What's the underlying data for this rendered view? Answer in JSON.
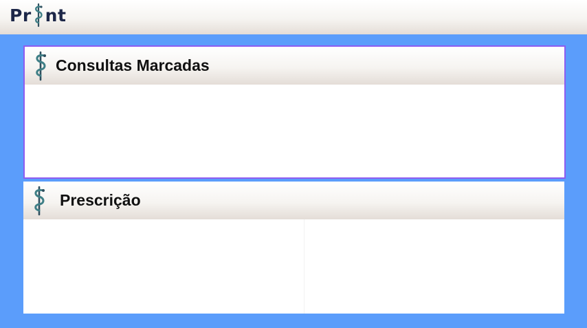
{
  "app": {
    "logo_text_start": "Pr",
    "logo_text_end": "nt"
  },
  "icons": {
    "logo_mark": "serpent-staff-icon",
    "panel_mark": "serpent-staff-icon"
  },
  "colors": {
    "workspace": "#5b9dfb",
    "panel_border_active": "#8e5cf0",
    "logo_text": "#1d2748",
    "icon_teal": "#3f7f86",
    "icon_dark": "#2f4f5e"
  },
  "panels": {
    "consultas": {
      "title": "Consultas Marcadas"
    },
    "prescricao": {
      "title": "Prescrição"
    }
  }
}
